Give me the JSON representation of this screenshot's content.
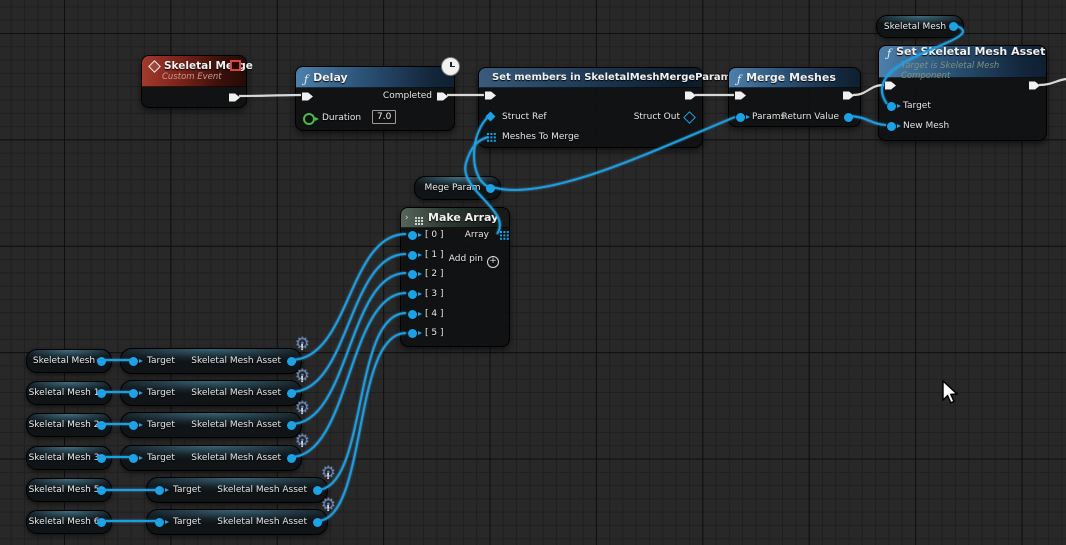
{
  "editor": {
    "type": "blueprint-graph"
  },
  "colors": {
    "background": "#282828",
    "grid_minor": "#1f1f1f",
    "grid_major": "#0e0e0e",
    "exec_wire": "#d9d9d9",
    "data_wire": "#1c9fe2",
    "event_header": "#a23a2c",
    "function_header": "#4c80ab",
    "make_array_header": "#55665c",
    "float_pin": "#4db84d",
    "object_pin": "#1ba2e6"
  },
  "nodes": {
    "skeletal_merge": {
      "icon": "custom-event-diamond",
      "title": "Skeletal Merge",
      "subtitle": "Custom Event"
    },
    "delay": {
      "icon": "function-f",
      "badge": "clock-latent",
      "title": "Delay",
      "completed_label": "Completed",
      "duration_label": "Duration",
      "duration_value": "7.0"
    },
    "set_members": {
      "icon": "struct-pill",
      "title": "Set members in SkeletalMeshMergeParams",
      "struct_ref_label": "Struct Ref",
      "struct_out_label": "Struct Out",
      "meshes_label": "Meshes To Merge"
    },
    "merge_meshes": {
      "icon": "function-f",
      "title": "Merge Meshes",
      "params_label": "Params",
      "return_label": "Return Value"
    },
    "set_skeletal_mesh_asset": {
      "icon": "function-f",
      "title": "Set Skeletal Mesh Asset",
      "subtitle": "Target is Skeletal Mesh Component",
      "target_label": "Target",
      "new_mesh_label": "New Mesh"
    },
    "skeletal_mesh_top": {
      "label": "Skeletal Mesh"
    },
    "mege_param": {
      "label": "Mege Param"
    },
    "make_array": {
      "icon": "make-array-grid",
      "title": "Make Array",
      "array_label": "Array",
      "add_pin_label": "Add pin",
      "inputs": [
        "[ 0 ]",
        "[ 1 ]",
        "[ 2 ]",
        "[ 3 ]",
        "[ 4 ]",
        "[ 5 ]"
      ]
    }
  },
  "variable_rows": [
    {
      "var_label": "Skeletal Mesh",
      "target_label": "Target",
      "out_label": "Skeletal Mesh Asset",
      "badge": "gear-alert"
    },
    {
      "var_label": "Skeletal Mesh 1",
      "target_label": "Target",
      "out_label": "Skeletal Mesh Asset",
      "badge": "gear-alert"
    },
    {
      "var_label": "Skeletal Mesh 2",
      "target_label": "Target",
      "out_label": "Skeletal Mesh Asset",
      "badge": "gear-alert"
    },
    {
      "var_label": "Skeletal Mesh 3",
      "target_label": "Target",
      "out_label": "Skeletal Mesh Asset",
      "badge": "gear-alert"
    },
    {
      "var_label": "Skeletal Mesh 5",
      "target_label": "Target",
      "out_label": "Skeletal Mesh Asset",
      "badge": "gear-alert"
    },
    {
      "var_label": "Skeletal Mesh 6",
      "target_label": "Target",
      "out_label": "Skeletal Mesh Asset",
      "badge": "gear-alert"
    }
  ]
}
